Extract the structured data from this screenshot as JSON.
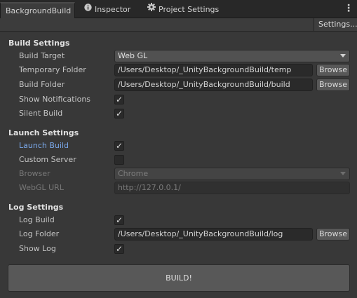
{
  "tabs": [
    {
      "label": "BackgroundBuild",
      "icon": "none"
    },
    {
      "label": "Inspector",
      "icon": "info-icon"
    },
    {
      "label": "Project Settings",
      "icon": "gear-icon"
    }
  ],
  "toolbar": {
    "settings_label": "Settings..."
  },
  "build_settings": {
    "header": "Build Settings",
    "build_target": {
      "label": "Build Target",
      "value": "Web GL"
    },
    "temp_folder": {
      "label": "Temporary Folder",
      "value": "/Users/Desktop/_UnityBackgroundBuild/temp",
      "button": "Browse"
    },
    "build_folder": {
      "label": "Build Folder",
      "value": "/Users/Desktop/_UnityBackgroundBuild/build",
      "button": "Browse"
    },
    "show_notifications": {
      "label": "Show Notifications",
      "checked": true
    },
    "silent_build": {
      "label": "Silent Build",
      "checked": true
    }
  },
  "launch_settings": {
    "header": "Launch Settings",
    "launch_build": {
      "label": "Launch Build",
      "checked": true
    },
    "custom_server": {
      "label": "Custom Server",
      "checked": false
    },
    "browser": {
      "label": "Browser",
      "value": "Chrome"
    },
    "webgl_url": {
      "label": "WebGL URL",
      "value": "http://127.0.0.1/"
    }
  },
  "log_settings": {
    "header": "Log Settings",
    "log_build": {
      "label": "Log Build",
      "checked": true
    },
    "log_folder": {
      "label": "Log Folder",
      "value": "/Users/Desktop/_UnityBackgroundBuild/log",
      "button": "Browse"
    },
    "show_log": {
      "label": "Show Log",
      "checked": true
    }
  },
  "build_button": "BUILD!",
  "check_glyph": "✓",
  "colors": {
    "background": "#383838",
    "link": "#7aa8ea",
    "tabbar": "#282828"
  }
}
